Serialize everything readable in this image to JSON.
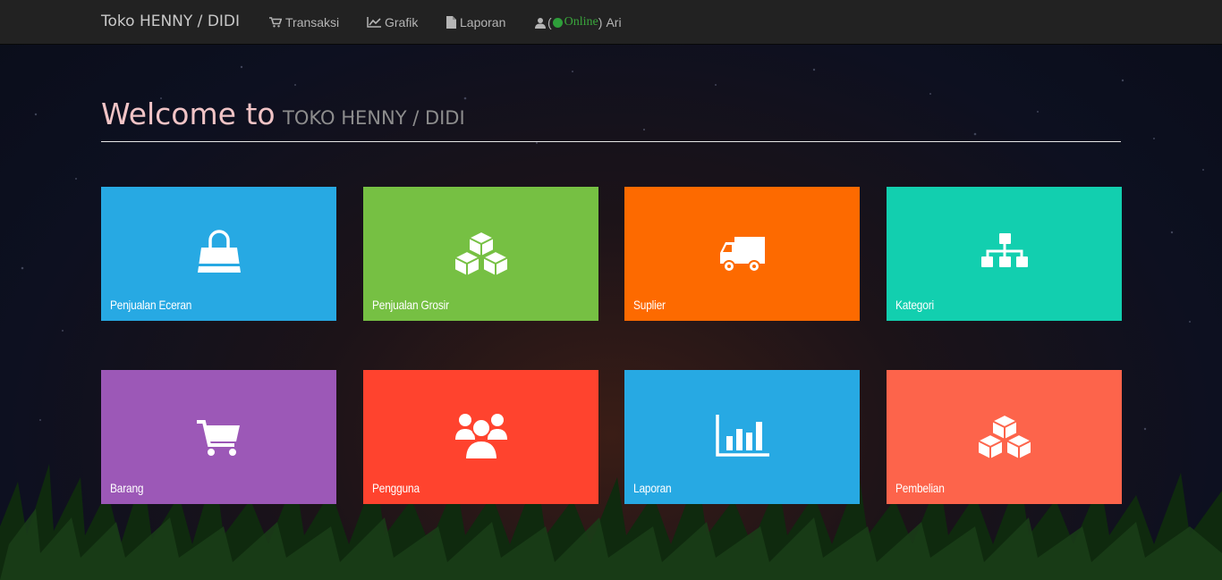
{
  "navbar": {
    "brand": "Toko HENNY / DIDI",
    "items": [
      {
        "label": "Transaksi",
        "icon": "shopping-cart-icon"
      },
      {
        "label": "Grafik",
        "icon": "line-chart-icon"
      },
      {
        "label": "Laporan",
        "icon": "file-icon"
      }
    ],
    "user": {
      "open_paren": "(",
      "status": "Online",
      "close_paren": ")",
      "name": "Ari",
      "icon": "user-icon",
      "status_color": "#2e9e3a"
    }
  },
  "heading": {
    "main": "Welcome to",
    "sub": "TOKO HENNY / DIDI"
  },
  "tiles": [
    {
      "label": "Penjualan Eceran",
      "icon": "shopping-bag-icon",
      "color": "#27a9e3"
    },
    {
      "label": "Penjualan Grosir",
      "icon": "cubes-icon",
      "color": "#76c043"
    },
    {
      "label": "Suplier",
      "icon": "truck-icon",
      "color": "#fd6a00"
    },
    {
      "label": "Kategori",
      "icon": "sitemap-icon",
      "color": "#12cfaf"
    },
    {
      "label": "Barang",
      "icon": "shopping-cart-icon",
      "color": "#9c58b7"
    },
    {
      "label": "Pengguna",
      "icon": "users-icon",
      "color": "#ff432e"
    },
    {
      "label": "Laporan",
      "icon": "bar-chart-icon",
      "color": "#27a9e3"
    },
    {
      "label": "Pembelian",
      "icon": "cubes-icon",
      "color": "#fd644b"
    }
  ]
}
